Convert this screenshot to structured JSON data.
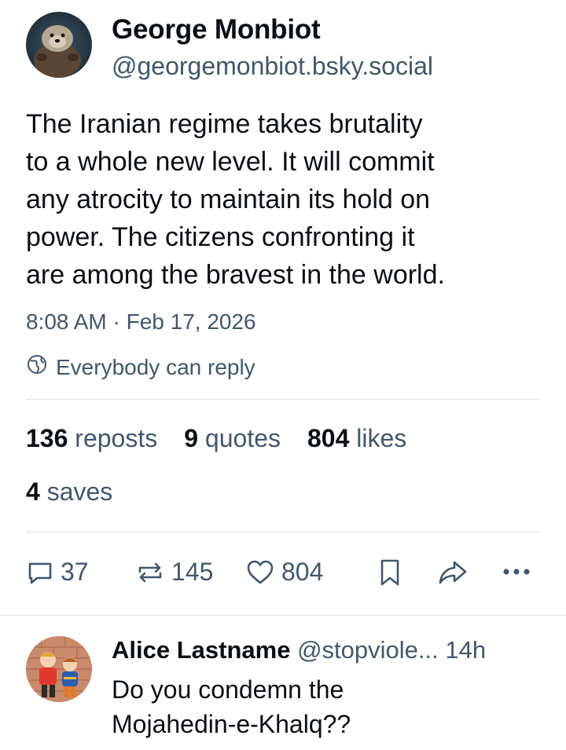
{
  "post": {
    "author_name": "George Monbiot",
    "author_handle": "@georgemonbiot.bsky.social",
    "text_lines": [
      "The Iranian regime takes brutality",
      "to a whole new level. It will commit",
      "any atrocity to maintain its hold on",
      "power. The citizens confronting it",
      "are among the bravest in the world."
    ],
    "timestamp": "8:08 AM · Feb 17, 2026",
    "reply_setting": "Everybody can reply"
  },
  "stats": {
    "reposts_count": "136",
    "reposts_label": "reposts",
    "quotes_count": "9",
    "quotes_label": "quotes",
    "likes_count": "804",
    "likes_label": "likes",
    "saves_count": "4",
    "saves_label": "saves"
  },
  "actions": {
    "reply_count": "37",
    "repost_count": "145",
    "like_count": "804"
  },
  "reply": {
    "author_name": "Alice Lastname",
    "author_handle": "@stopviole...",
    "time": "14h",
    "text_lines": [
      "Do you condemn the",
      "Mojahedin-e-Khalq??"
    ]
  },
  "colors": {
    "text_primary": "#0b0f14",
    "text_secondary": "#42576c",
    "divider": "#dbe1e8"
  },
  "icons": [
    "globe-icon",
    "reply-icon",
    "repost-icon",
    "heart-icon",
    "bookmark-icon",
    "share-icon",
    "more-icon"
  ]
}
